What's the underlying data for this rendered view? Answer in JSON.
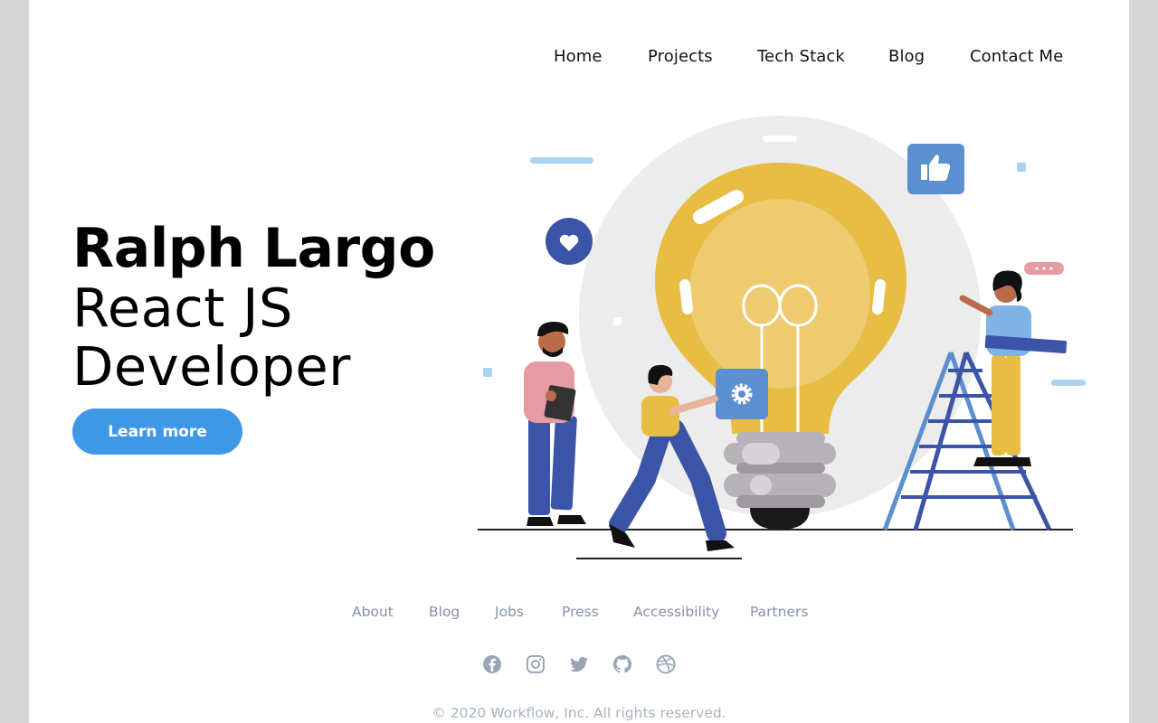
{
  "nav": {
    "items": [
      {
        "label": "Home"
      },
      {
        "label": "Projects"
      },
      {
        "label": "Tech Stack"
      },
      {
        "label": "Blog"
      },
      {
        "label": "Contact Me"
      }
    ]
  },
  "hero": {
    "name": "Ralph Largo",
    "role_line1": "React JS",
    "role_line2": "Developer",
    "cta_label": "Learn more",
    "cta_color": "#3f98e6"
  },
  "illustration": {
    "icons": [
      "lightbulb-icon",
      "thumbs-up-icon",
      "heart-icon",
      "gear-icon",
      "chat-bubble-icon"
    ]
  },
  "footer": {
    "links": [
      {
        "label": "About"
      },
      {
        "label": "Blog"
      },
      {
        "label": "Jobs"
      },
      {
        "label": "Press"
      },
      {
        "label": "Accessibility"
      },
      {
        "label": "Partners"
      }
    ],
    "social": [
      "facebook-icon",
      "instagram-icon",
      "twitter-icon",
      "github-icon",
      "dribbble-icon"
    ],
    "copyright": "© 2020 Workflow, Inc. All rights reserved."
  }
}
